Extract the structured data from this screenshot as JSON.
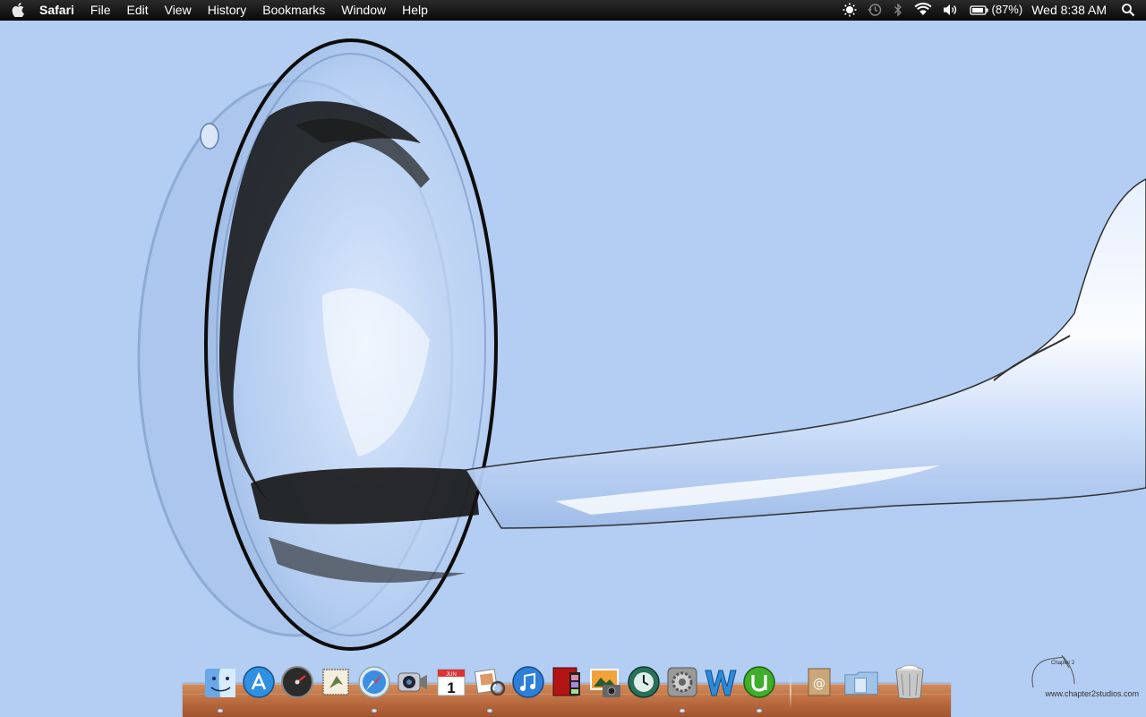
{
  "menubar": {
    "app_name": "Safari",
    "menus": [
      "File",
      "Edit",
      "View",
      "History",
      "Bookmarks",
      "Window",
      "Help"
    ],
    "status": {
      "icons": [
        "brightness-icon",
        "time-machine-icon",
        "bluetooth-icon",
        "wifi-icon",
        "volume-icon",
        "battery-icon",
        "spotlight-icon"
      ],
      "battery_percent": "(87%)",
      "clock": "Wed 8:38 AM"
    }
  },
  "desktop": {
    "wallpaper": "water splash",
    "watermark_text": "www.chapter2studios.com",
    "watermark_small": "Chapter 2"
  },
  "dock": {
    "items": [
      {
        "name": "Finder",
        "icon": "finder-icon",
        "running": true
      },
      {
        "name": "App Store",
        "icon": "app-store-icon",
        "running": false
      },
      {
        "name": "Dashboard",
        "icon": "dashboard-icon",
        "running": false
      },
      {
        "name": "Mail",
        "icon": "mail-icon",
        "running": false
      },
      {
        "name": "Safari",
        "icon": "safari-icon",
        "running": true
      },
      {
        "name": "FaceTime",
        "icon": "facetime-icon",
        "running": false
      },
      {
        "name": "iCal",
        "icon": "calendar-icon",
        "running": false,
        "date": "1",
        "month": "JUN"
      },
      {
        "name": "Address Book",
        "icon": "address-book-icon",
        "running": true
      },
      {
        "name": "iTunes",
        "icon": "itunes-icon",
        "running": false
      },
      {
        "name": "Photo Booth",
        "icon": "photo-booth-icon",
        "running": false
      },
      {
        "name": "iPhoto",
        "icon": "iphoto-icon",
        "running": false
      },
      {
        "name": "Time Machine",
        "icon": "time-machine-dock-icon",
        "running": false
      },
      {
        "name": "System Preferences",
        "icon": "system-preferences-icon",
        "running": true
      },
      {
        "name": "Word",
        "icon": "word-icon",
        "running": false
      },
      {
        "name": "uTorrent",
        "icon": "utorrent-icon",
        "running": true
      },
      {
        "name": "Applications",
        "icon": "applications-folder-icon",
        "running": false
      },
      {
        "name": "Documents",
        "icon": "documents-folder-icon",
        "running": false
      },
      {
        "name": "Trash",
        "icon": "trash-icon",
        "running": false
      }
    ],
    "colors": {
      "shelf": "#b7673b"
    }
  },
  "colors": {
    "desktop_bg": "#b4cdf2",
    "menubar_bg": "#111111"
  }
}
